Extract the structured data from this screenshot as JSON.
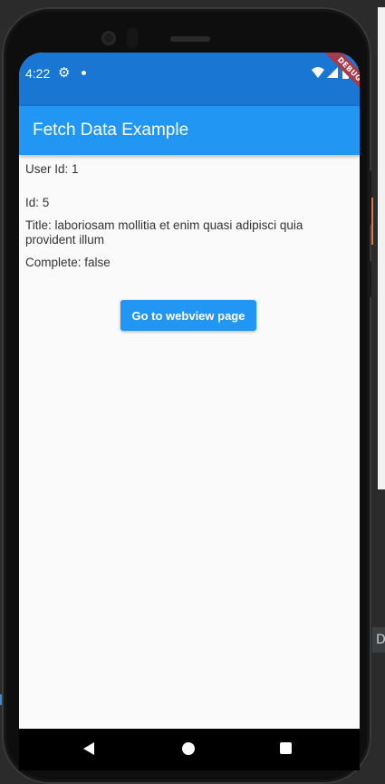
{
  "status_bar": {
    "time": "4:22",
    "settings_icon": "gear-icon",
    "notification_dot_icon": "dot-icon",
    "wifi_icon": "wifi-icon",
    "signal_icon": "signal-icon",
    "battery_icon": "battery-icon",
    "debug_banner": "DEBUG",
    "color": "#1976d2"
  },
  "app_bar": {
    "title": "Fetch Data Example",
    "color": "#2196f3"
  },
  "content": {
    "user_id": "User Id: 1",
    "id": "Id: 5",
    "title_line1": "Title: laboriosam mollitia et enim quasi adipisci quia",
    "title_line2": "provident illum",
    "complete": "Complete: false",
    "button_label": "Go to webview page"
  },
  "nav_bar": {
    "back_icon": "back-triangle-icon",
    "home_icon": "home-circle-icon",
    "recents_icon": "recents-square-icon"
  },
  "ide": {
    "side_label": "D"
  }
}
